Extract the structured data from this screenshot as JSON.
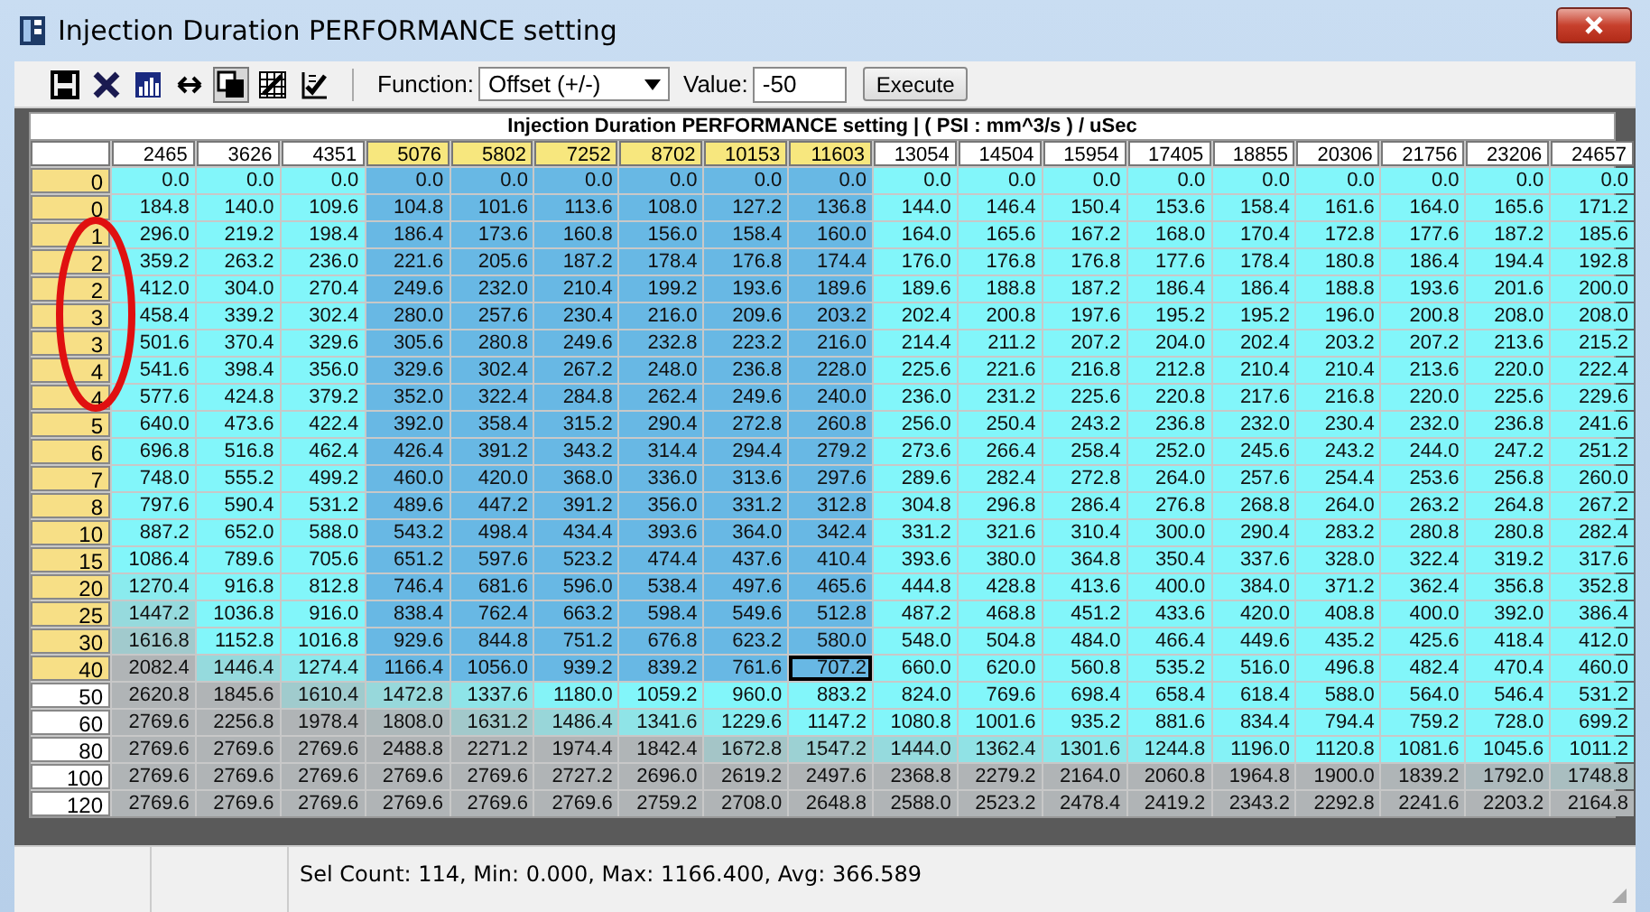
{
  "window": {
    "title": "Injection Duration PERFORMANCE setting"
  },
  "toolbar": {
    "buttons": [
      {
        "kind": "save",
        "pressed": false
      },
      {
        "kind": "delete",
        "pressed": false
      },
      {
        "kind": "chart",
        "pressed": false
      },
      {
        "kind": "swap",
        "pressed": false
      },
      {
        "kind": "copy",
        "pressed": true
      },
      {
        "kind": "grid",
        "pressed": false
      },
      {
        "kind": "gridcheck",
        "pressed": false
      }
    ],
    "function_label": "Function:",
    "function_value": "Offset (+/-)",
    "value_label": "Value:",
    "value": "-50",
    "execute": "Execute"
  },
  "table": {
    "title": "Injection Duration PERFORMANCE setting |  ( PSI : mm^3/s ) / uSec",
    "columns": [
      {
        "label": "2465",
        "selected": false
      },
      {
        "label": "3626",
        "selected": false
      },
      {
        "label": "4351",
        "selected": false
      },
      {
        "label": "5076",
        "selected": true
      },
      {
        "label": "5802",
        "selected": true
      },
      {
        "label": "7252",
        "selected": true
      },
      {
        "label": "8702",
        "selected": true
      },
      {
        "label": "10153",
        "selected": true
      },
      {
        "label": "11603",
        "selected": true
      },
      {
        "label": "13054",
        "selected": false
      },
      {
        "label": "14504",
        "selected": false
      },
      {
        "label": "15954",
        "selected": false
      },
      {
        "label": "17405",
        "selected": false
      },
      {
        "label": "18855",
        "selected": false
      },
      {
        "label": "20306",
        "selected": false
      },
      {
        "label": "21756",
        "selected": false
      },
      {
        "label": "23206",
        "selected": false
      },
      {
        "label": "24657",
        "selected": false
      }
    ],
    "rows": [
      {
        "label": "0",
        "selected": true,
        "cells": [
          "0.0",
          "0.0",
          "0.0",
          "0.0",
          "0.0",
          "0.0",
          "0.0",
          "0.0",
          "0.0",
          "0.0",
          "0.0",
          "0.0",
          "0.0",
          "0.0",
          "0.0",
          "0.0",
          "0.0",
          "0.0"
        ]
      },
      {
        "label": "0",
        "selected": true,
        "cells": [
          "184.8",
          "140.0",
          "109.6",
          "104.8",
          "101.6",
          "113.6",
          "108.0",
          "127.2",
          "136.8",
          "144.0",
          "146.4",
          "150.4",
          "153.6",
          "158.4",
          "161.6",
          "164.0",
          "165.6",
          "171.2"
        ]
      },
      {
        "label": "1",
        "selected": true,
        "cells": [
          "296.0",
          "219.2",
          "198.4",
          "186.4",
          "173.6",
          "160.8",
          "156.0",
          "158.4",
          "160.0",
          "164.0",
          "165.6",
          "167.2",
          "168.0",
          "170.4",
          "172.8",
          "177.6",
          "187.2",
          "185.6"
        ]
      },
      {
        "label": "2",
        "selected": true,
        "cells": [
          "359.2",
          "263.2",
          "236.0",
          "221.6",
          "205.6",
          "187.2",
          "178.4",
          "176.8",
          "174.4",
          "176.0",
          "176.8",
          "176.8",
          "177.6",
          "178.4",
          "180.8",
          "186.4",
          "194.4",
          "192.8"
        ]
      },
      {
        "label": "2",
        "selected": true,
        "cells": [
          "412.0",
          "304.0",
          "270.4",
          "249.6",
          "232.0",
          "210.4",
          "199.2",
          "193.6",
          "189.6",
          "189.6",
          "188.8",
          "187.2",
          "186.4",
          "186.4",
          "188.8",
          "193.6",
          "201.6",
          "200.0"
        ]
      },
      {
        "label": "3",
        "selected": true,
        "cells": [
          "458.4",
          "339.2",
          "302.4",
          "280.0",
          "257.6",
          "230.4",
          "216.0",
          "209.6",
          "203.2",
          "202.4",
          "200.8",
          "197.6",
          "195.2",
          "195.2",
          "196.0",
          "200.8",
          "208.0",
          "208.0"
        ]
      },
      {
        "label": "3",
        "selected": true,
        "cells": [
          "501.6",
          "370.4",
          "329.6",
          "305.6",
          "280.8",
          "249.6",
          "232.8",
          "223.2",
          "216.0",
          "214.4",
          "211.2",
          "207.2",
          "204.0",
          "202.4",
          "203.2",
          "207.2",
          "213.6",
          "215.2"
        ]
      },
      {
        "label": "4",
        "selected": true,
        "cells": [
          "541.6",
          "398.4",
          "356.0",
          "329.6",
          "302.4",
          "267.2",
          "248.0",
          "236.8",
          "228.0",
          "225.6",
          "221.6",
          "216.8",
          "212.8",
          "210.4",
          "210.4",
          "213.6",
          "220.0",
          "222.4"
        ]
      },
      {
        "label": "4",
        "selected": true,
        "cells": [
          "577.6",
          "424.8",
          "379.2",
          "352.0",
          "322.4",
          "284.8",
          "262.4",
          "249.6",
          "240.0",
          "236.0",
          "231.2",
          "225.6",
          "220.8",
          "217.6",
          "216.8",
          "220.0",
          "225.6",
          "229.6"
        ]
      },
      {
        "label": "5",
        "selected": true,
        "cells": [
          "640.0",
          "473.6",
          "422.4",
          "392.0",
          "358.4",
          "315.2",
          "290.4",
          "272.8",
          "260.8",
          "256.0",
          "250.4",
          "243.2",
          "236.8",
          "232.0",
          "230.4",
          "232.0",
          "236.8",
          "241.6"
        ]
      },
      {
        "label": "6",
        "selected": true,
        "cells": [
          "696.8",
          "516.8",
          "462.4",
          "426.4",
          "391.2",
          "343.2",
          "314.4",
          "294.4",
          "279.2",
          "273.6",
          "266.4",
          "258.4",
          "252.0",
          "245.6",
          "243.2",
          "244.0",
          "247.2",
          "251.2"
        ]
      },
      {
        "label": "7",
        "selected": true,
        "cells": [
          "748.0",
          "555.2",
          "499.2",
          "460.0",
          "420.0",
          "368.0",
          "336.0",
          "313.6",
          "297.6",
          "289.6",
          "282.4",
          "272.8",
          "264.0",
          "257.6",
          "254.4",
          "253.6",
          "256.8",
          "260.0"
        ]
      },
      {
        "label": "8",
        "selected": true,
        "cells": [
          "797.6",
          "590.4",
          "531.2",
          "489.6",
          "447.2",
          "391.2",
          "356.0",
          "331.2",
          "312.8",
          "304.8",
          "296.8",
          "286.4",
          "276.8",
          "268.8",
          "264.0",
          "263.2",
          "264.8",
          "267.2"
        ]
      },
      {
        "label": "10",
        "selected": true,
        "cells": [
          "887.2",
          "652.0",
          "588.0",
          "543.2",
          "498.4",
          "434.4",
          "393.6",
          "364.0",
          "342.4",
          "331.2",
          "321.6",
          "310.4",
          "300.0",
          "290.4",
          "283.2",
          "280.8",
          "280.8",
          "282.4"
        ]
      },
      {
        "label": "15",
        "selected": true,
        "cells": [
          "1086.4",
          "789.6",
          "705.6",
          "651.2",
          "597.6",
          "523.2",
          "474.4",
          "437.6",
          "410.4",
          "393.6",
          "380.0",
          "364.8",
          "350.4",
          "337.6",
          "328.0",
          "322.4",
          "319.2",
          "317.6"
        ]
      },
      {
        "label": "20",
        "selected": true,
        "cells": [
          "1270.4",
          "916.8",
          "812.8",
          "746.4",
          "681.6",
          "596.0",
          "538.4",
          "497.6",
          "465.6",
          "444.8",
          "428.8",
          "413.6",
          "400.0",
          "384.0",
          "371.2",
          "362.4",
          "356.8",
          "352.8"
        ]
      },
      {
        "label": "25",
        "selected": true,
        "cells": [
          "1447.2",
          "1036.8",
          "916.0",
          "838.4",
          "762.4",
          "663.2",
          "598.4",
          "549.6",
          "512.8",
          "487.2",
          "468.8",
          "451.2",
          "433.6",
          "420.0",
          "408.8",
          "400.0",
          "392.0",
          "386.4"
        ]
      },
      {
        "label": "30",
        "selected": true,
        "cells": [
          "1616.8",
          "1152.8",
          "1016.8",
          "929.6",
          "844.8",
          "751.2",
          "676.8",
          "623.2",
          "580.0",
          "548.0",
          "504.8",
          "484.0",
          "466.4",
          "449.6",
          "435.2",
          "425.6",
          "418.4",
          "412.0"
        ]
      },
      {
        "label": "40",
        "selected": true,
        "cells": [
          "2082.4",
          "1446.4",
          "1274.4",
          "1166.4",
          "1056.0",
          "939.2",
          "839.2",
          "761.6",
          {
            "value": "707.2",
            "cursor": true
          },
          "660.0",
          "620.0",
          "560.8",
          "535.2",
          "516.0",
          "496.8",
          "482.4",
          "470.4",
          "460.0"
        ]
      },
      {
        "label": "50",
        "selected": false,
        "cells": [
          "2620.8",
          "1845.6",
          "1610.4",
          "1472.8",
          "1337.6",
          "1180.0",
          "1059.2",
          "960.0",
          "883.2",
          "824.0",
          "769.6",
          "698.4",
          "658.4",
          "618.4",
          "588.0",
          "564.0",
          "546.4",
          "531.2"
        ]
      },
      {
        "label": "60",
        "selected": false,
        "cells": [
          "2769.6",
          "2256.8",
          "1978.4",
          "1808.0",
          "1631.2",
          "1486.4",
          "1341.6",
          "1229.6",
          "1147.2",
          "1080.8",
          "1001.6",
          "935.2",
          "881.6",
          "834.4",
          "794.4",
          "759.2",
          "728.0",
          "699.2"
        ]
      },
      {
        "label": "80",
        "selected": false,
        "cells": [
          "2769.6",
          "2769.6",
          "2769.6",
          "2488.8",
          "2271.2",
          "1974.4",
          "1842.4",
          "1672.8",
          "1547.2",
          "1444.0",
          "1362.4",
          "1301.6",
          "1244.8",
          "1196.0",
          "1120.8",
          "1081.6",
          "1045.6",
          "1011.2"
        ]
      },
      {
        "label": "100",
        "selected": false,
        "cells": [
          "2769.6",
          "2769.6",
          "2769.6",
          "2769.6",
          "2769.6",
          "2727.2",
          "2696.0",
          "2619.2",
          "2497.6",
          "2368.8",
          "2279.2",
          "2164.0",
          "2060.8",
          "1964.8",
          "1900.0",
          "1839.2",
          "1792.0",
          "1748.8"
        ]
      },
      {
        "label": "120",
        "selected": false,
        "cells": [
          "2769.6",
          "2769.6",
          "2769.6",
          "2769.6",
          "2769.6",
          "2769.6",
          "2759.2",
          "2708.0",
          "2648.8",
          "2588.0",
          "2523.2",
          "2478.4",
          "2419.2",
          "2343.2",
          "2292.8",
          "2241.6",
          "2203.2",
          "2164.8"
        ]
      }
    ]
  },
  "status_bar": {
    "text": "Sel Count: 114, Min: 0.000, Max: 1166.400, Avg: 366.589"
  }
}
